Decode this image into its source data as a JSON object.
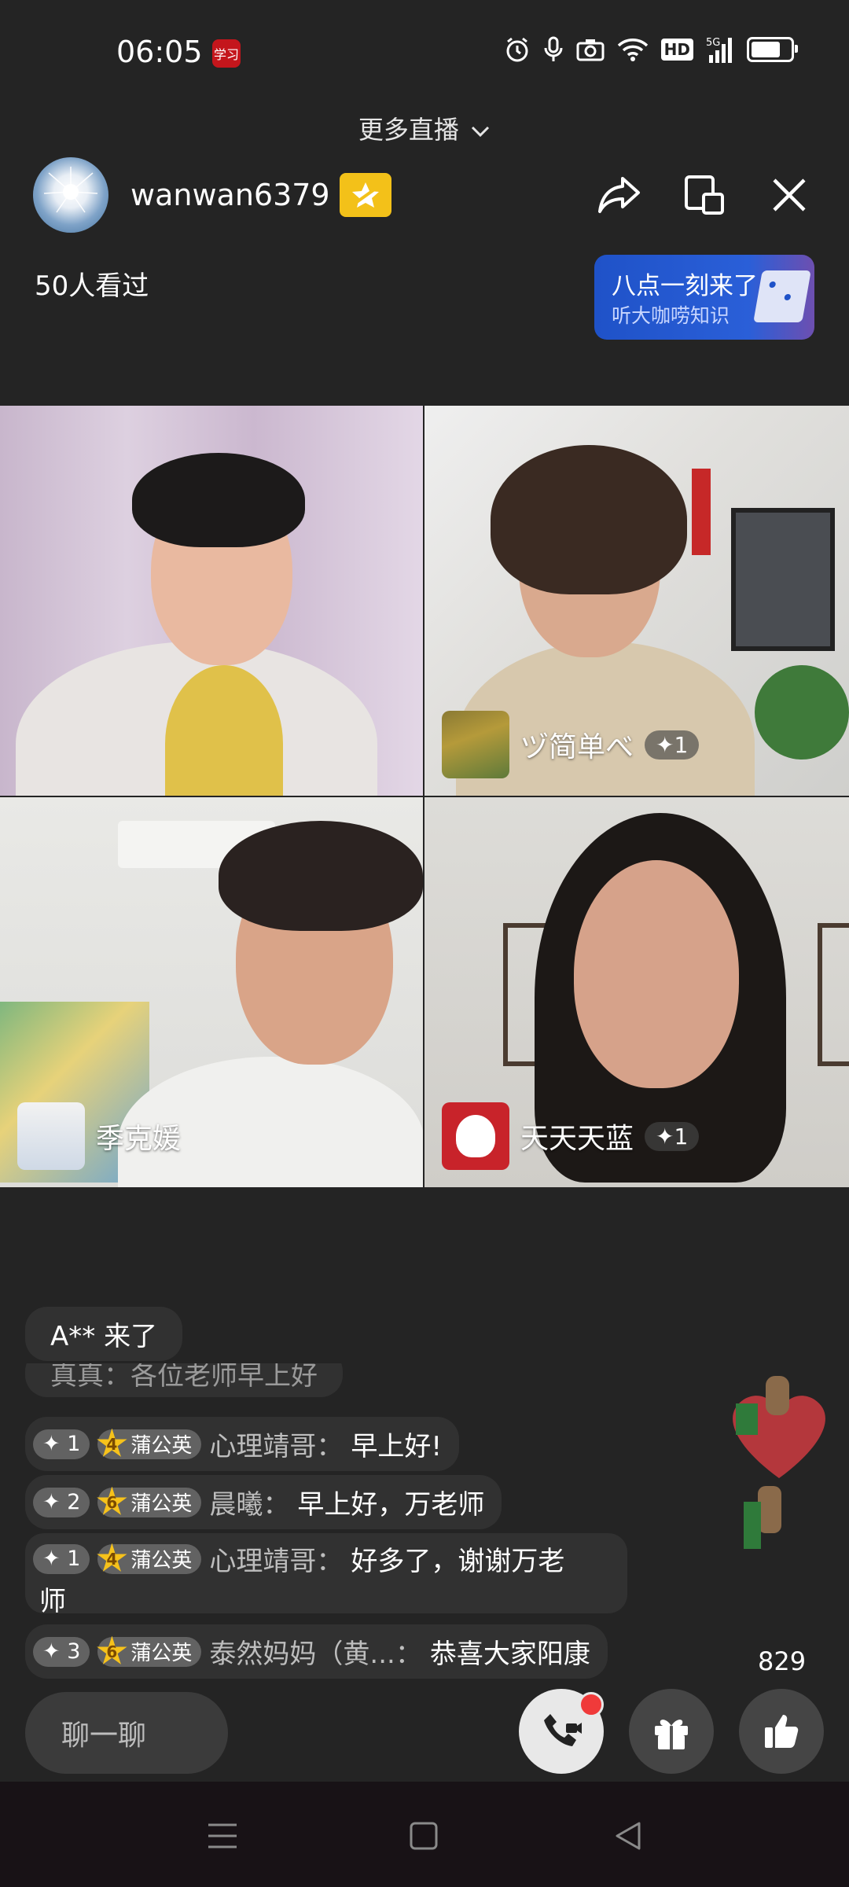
{
  "status": {
    "time": "06:05",
    "app_icon_text": "学习",
    "network": "5G",
    "hd": "HD",
    "battery_level": 0.75
  },
  "header": {
    "more_live": "更多直播",
    "host_name": "wanwan6379",
    "viewed": "50人看过",
    "promo_title": "八点一刻来了",
    "promo_subtitle": "听大咖唠知识"
  },
  "participants": [
    {
      "name": "",
      "badge": ""
    },
    {
      "name": "ヅ简单べ",
      "badge": "✦1"
    },
    {
      "name": "季克媛",
      "badge": ""
    },
    {
      "name": "天天天蓝",
      "badge": "✦1"
    }
  ],
  "join_notice": "A** 来了",
  "chat": {
    "faded_line": "真真：各位老师早上好",
    "messages": [
      {
        "level": "✦ 1",
        "fan_level": "4",
        "fan_name": "蒲公英",
        "user": "心理靖哥：",
        "text": "早上好!"
      },
      {
        "level": "✦ 2",
        "fan_level": "6",
        "fan_name": "蒲公英",
        "user": "晨曦：",
        "text": "早上好，万老师"
      },
      {
        "level": "✦ 1",
        "fan_level": "4",
        "fan_name": "蒲公英",
        "user": "心理靖哥：",
        "text": "好多了，谢谢万老",
        "text_cont": "师"
      },
      {
        "level": "✦ 3",
        "fan_level": "6",
        "fan_name": "蒲公英",
        "user": "泰然妈妈（黄...：",
        "text": "恭喜大家阳康"
      }
    ]
  },
  "actions": {
    "input_placeholder": "聊一聊",
    "like_count": "829"
  },
  "icons": [
    "chevron-down-icon",
    "share-icon",
    "mini-window-icon",
    "close-icon",
    "call-icon",
    "gift-icon",
    "thumbs-up-icon",
    "menu-icon",
    "home-icon",
    "back-icon"
  ],
  "colors": {
    "accent_blue": "#2a5fd8",
    "badge_gold": "#f3c119",
    "red_dot": "#f03a3a"
  }
}
